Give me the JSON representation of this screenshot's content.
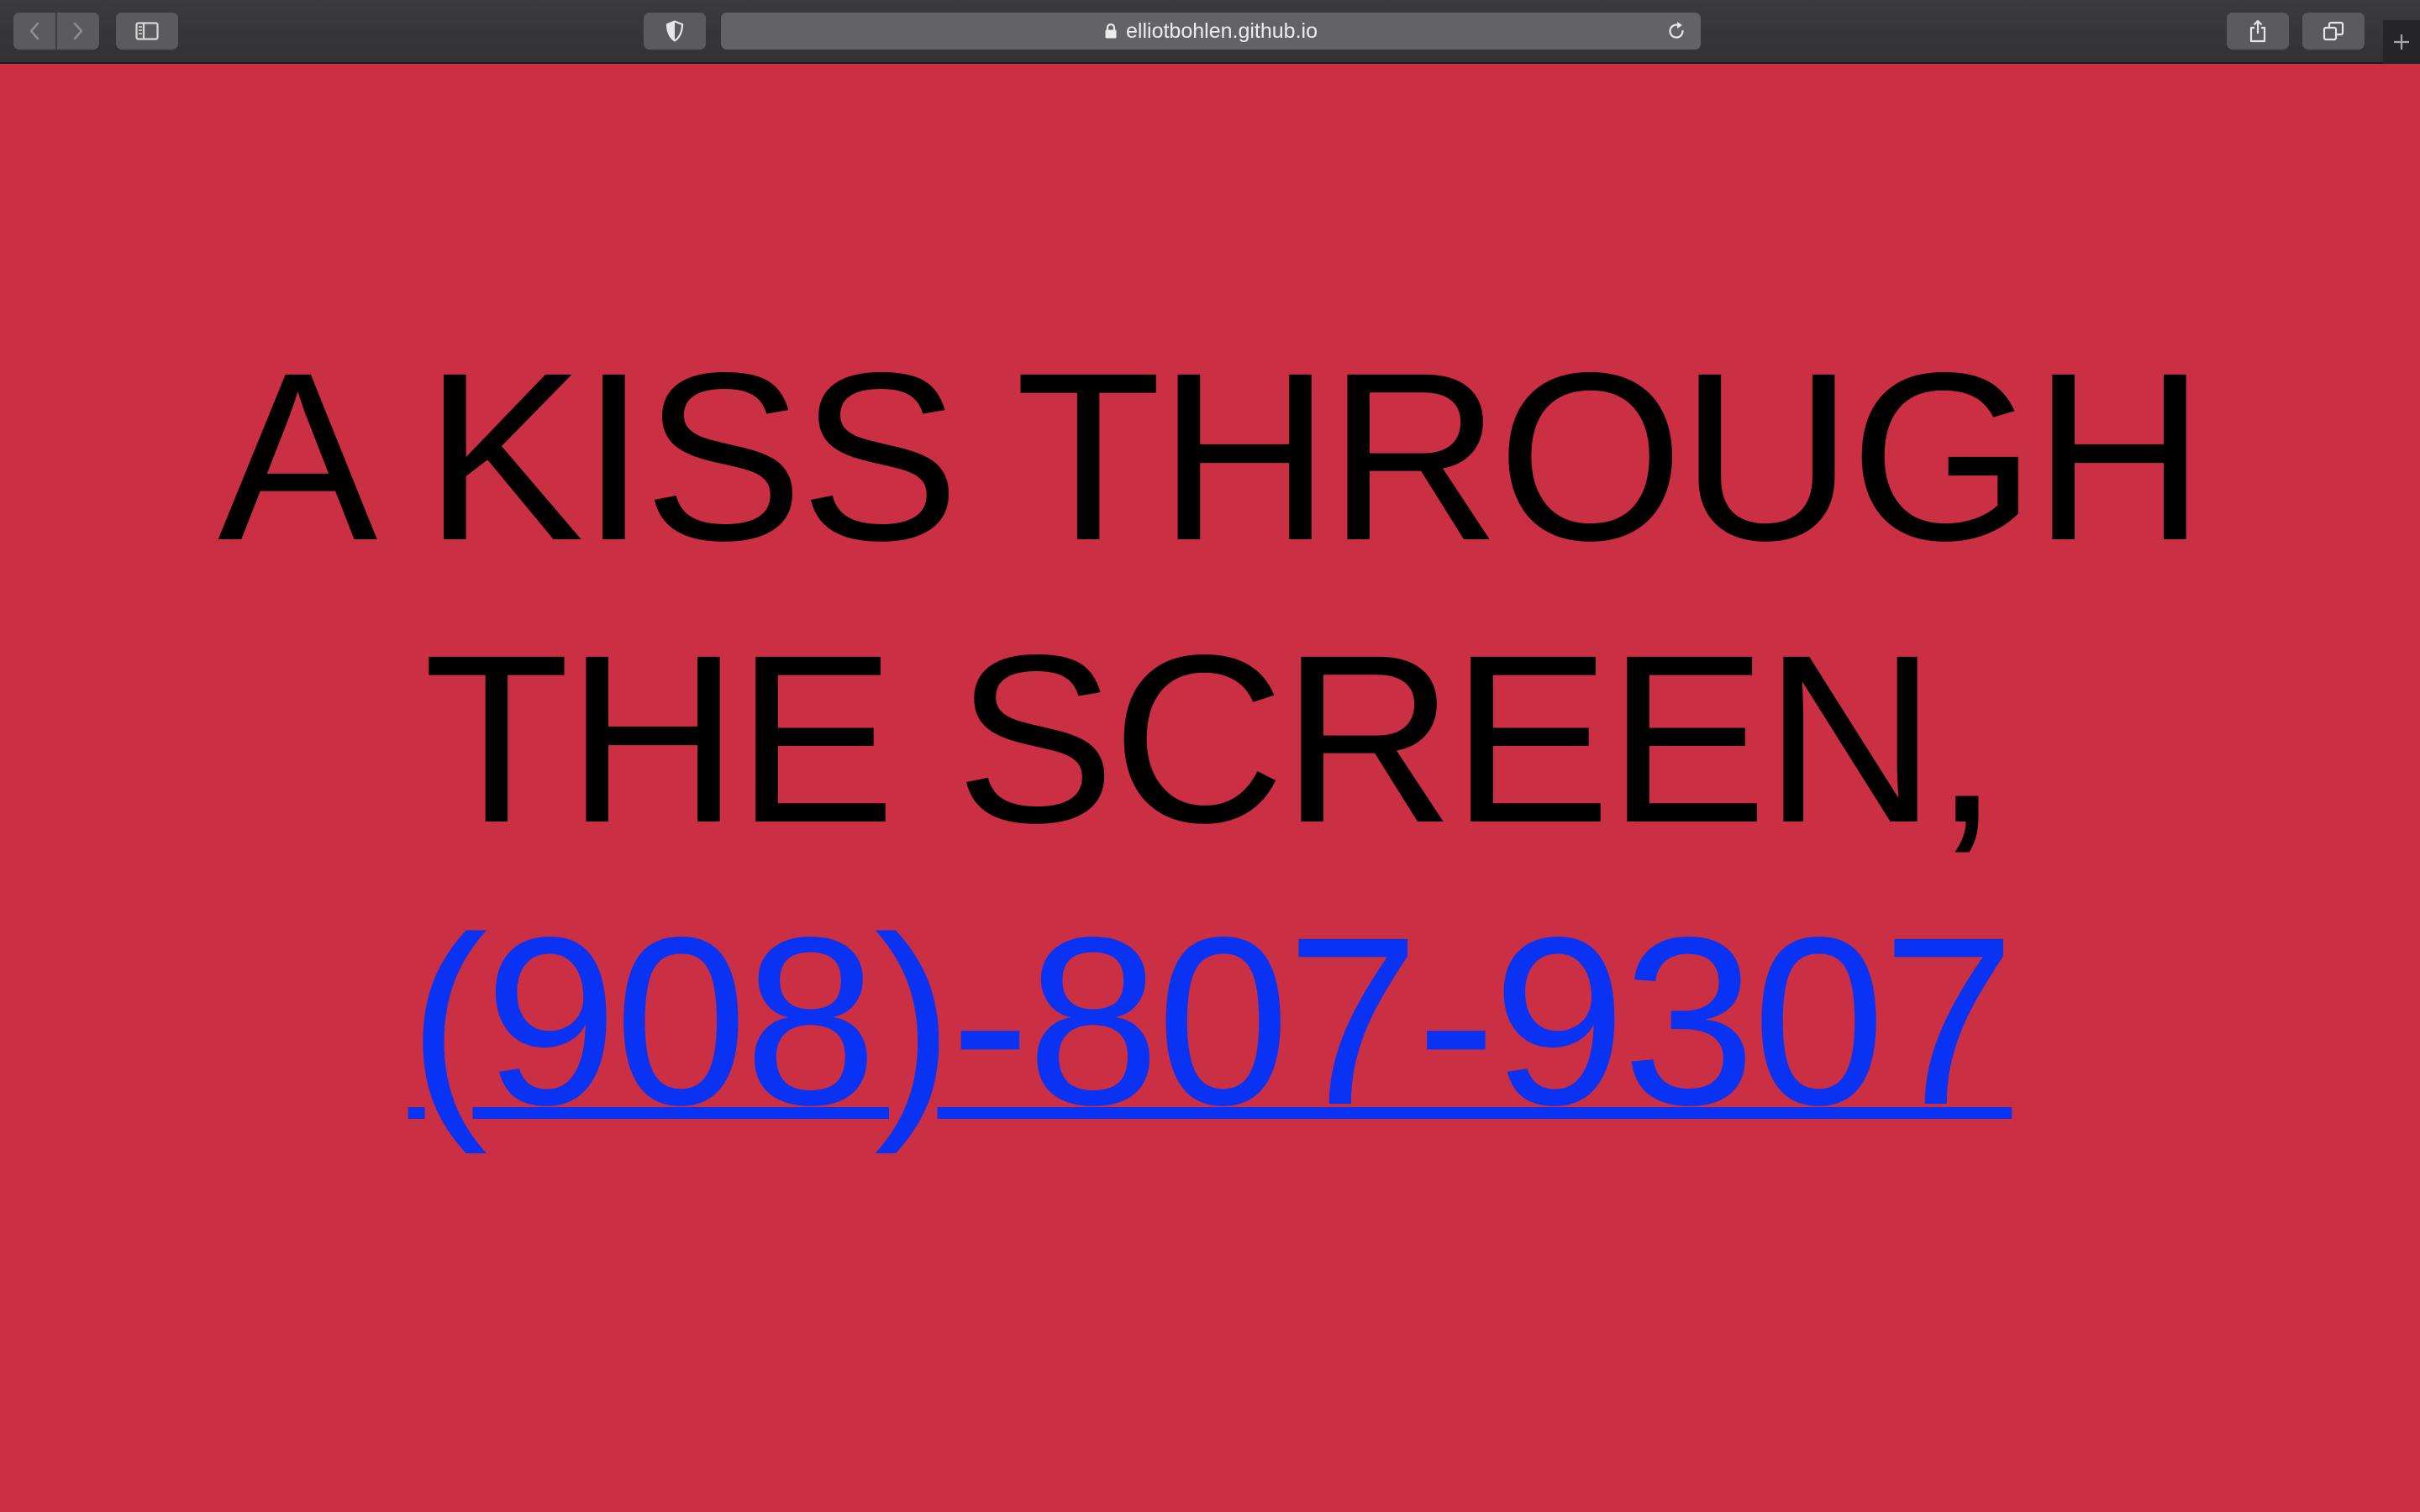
{
  "browser": {
    "url_display": "elliotbohlen.github.io",
    "icons": {
      "back": "chevron-left-icon",
      "forward": "chevron-right-icon",
      "sidebar": "sidebar-icon",
      "privacy": "shield-icon",
      "lock": "lock-icon",
      "reload": "reload-icon",
      "share": "share-icon",
      "tabs": "tabs-overview-icon",
      "new_tab": "plus-icon"
    }
  },
  "page": {
    "background_color": "#cb2f43",
    "headline_line1": "A KISS THROUGH",
    "headline_line2": "THE SCREEN,",
    "phone_link": "(908)-807-9307",
    "link_color": "#0a32f2"
  }
}
